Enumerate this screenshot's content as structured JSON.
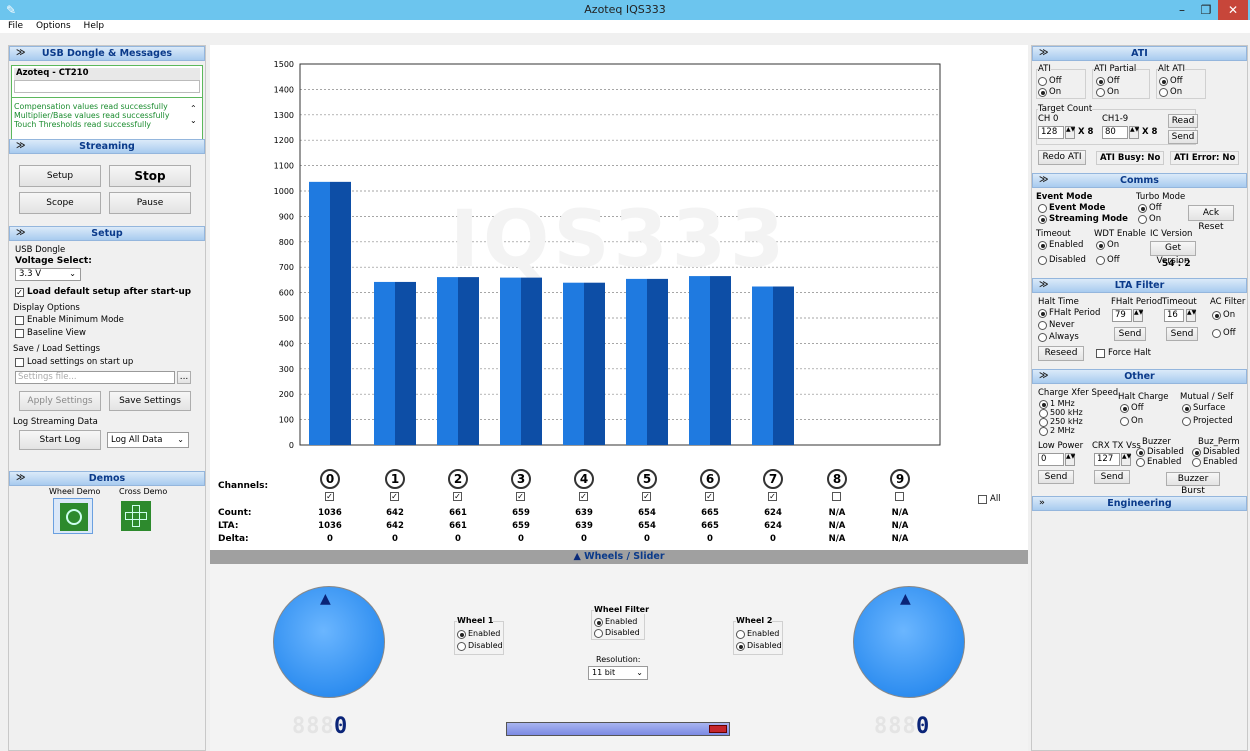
{
  "window": {
    "title": "Azoteq IQS333",
    "min": "–",
    "max": "❐",
    "close": "✕"
  },
  "menu": [
    "File",
    "Options",
    "Help"
  ],
  "left": {
    "usb_header": "USB Dongle & Messages",
    "device": "Azoteq - CT210",
    "messages": [
      "Compensation values read successfully",
      "Multiplier/Base values read successfully",
      "Touch Thresholds read successfully"
    ],
    "streaming_header": "Streaming",
    "setup_btn": "Setup",
    "stop_btn": "Stop",
    "scope_btn": "Scope",
    "pause_btn": "Pause",
    "setup_header": "Setup",
    "usb_dongle": "USB Dongle",
    "voltage_label": "Voltage Select:",
    "voltage_value": "3.3 V",
    "load_default": "Load default setup after start-up",
    "display_options": "Display Options",
    "enable_min": "Enable Minimum Mode",
    "baseline_view": "Baseline View",
    "save_load": "Save / Load Settings",
    "load_on_start": "Load settings on start up",
    "settings_placeholder": "Settings file...",
    "browse": "...",
    "apply_btn": "Apply Settings",
    "save_btn": "Save Settings",
    "log_label": "Log Streaming Data",
    "start_log": "Start Log",
    "log_option": "Log All Data",
    "demos_header": "Demos",
    "wheel_demo": "Wheel Demo",
    "cross_demo": "Cross Demo"
  },
  "chart_data": {
    "type": "bar",
    "categories": [
      "0",
      "1",
      "2",
      "3",
      "4",
      "5",
      "6",
      "7"
    ],
    "values": [
      1036,
      642,
      661,
      659,
      639,
      654,
      665,
      624
    ],
    "ylim": [
      0,
      1500
    ],
    "yticks": [
      0,
      100,
      200,
      300,
      400,
      500,
      600,
      700,
      800,
      900,
      1000,
      1100,
      1200,
      1300,
      1400,
      1500
    ],
    "grid": true,
    "watermark": "IQS333",
    "bar_color": "#1a6fd6"
  },
  "table": {
    "channels_label": "Channels:",
    "count_label": "Count:",
    "lta_label": "LTA:",
    "delta_label": "Delta:",
    "all_label": "All",
    "channels": [
      {
        "n": "0",
        "checked": true,
        "count": "1036",
        "lta": "1036",
        "delta": "0"
      },
      {
        "n": "1",
        "checked": true,
        "count": "642",
        "lta": "642",
        "delta": "0"
      },
      {
        "n": "2",
        "checked": true,
        "count": "661",
        "lta": "661",
        "delta": "0"
      },
      {
        "n": "3",
        "checked": true,
        "count": "659",
        "lta": "659",
        "delta": "0"
      },
      {
        "n": "4",
        "checked": true,
        "count": "639",
        "lta": "639",
        "delta": "0"
      },
      {
        "n": "5",
        "checked": true,
        "count": "654",
        "lta": "654",
        "delta": "0"
      },
      {
        "n": "6",
        "checked": true,
        "count": "665",
        "lta": "665",
        "delta": "0"
      },
      {
        "n": "7",
        "checked": true,
        "count": "624",
        "lta": "624",
        "delta": "0"
      },
      {
        "n": "8",
        "checked": false,
        "count": "N/A",
        "lta": "N/A",
        "delta": "N/A"
      },
      {
        "n": "9",
        "checked": false,
        "count": "N/A",
        "lta": "N/A",
        "delta": "N/A"
      }
    ]
  },
  "wheels": {
    "header": "Wheels / Slider",
    "wheel1": "Wheel 1",
    "wheel2": "Wheel 2",
    "enabled": "Enabled",
    "disabled": "Disabled",
    "filter": "Wheel Filter",
    "resolution": "Resolution:",
    "resolution_value": "11 bit",
    "wheel1_display": "0",
    "wheel2_display": "0"
  },
  "right": {
    "ati_header": "ATI",
    "ati": "ATI",
    "ati_partial": "ATI Partial",
    "alt_ati": "Alt ATI",
    "off": "Off",
    "on": "On",
    "target_count": "Target Count",
    "ch0": "CH 0",
    "ch19": "CH1-9",
    "ch0_val": "128",
    "ch19_val": "80",
    "x8": "X 8",
    "read_btn": "Read",
    "send_btn": "Send",
    "redo_ati": "Redo ATI",
    "ati_busy": "ATI Busy: No",
    "ati_error": "ATI Error: No",
    "comms_header": "Comms",
    "event_mode_title": "Event Mode",
    "event_mode": "Event Mode",
    "streaming_mode": "Streaming Mode",
    "turbo_mode": "Turbo Mode",
    "ack_reset": "Ack Reset",
    "timeout": "Timeout",
    "wdt_enable": "WDT Enable",
    "ic_version": "IC Version",
    "enabled": "Enabled",
    "disabled": "Disabled",
    "get_version": "Get Version",
    "version": "54 : 2",
    "lta_header": "LTA Filter",
    "halt_time": "Halt Time",
    "fhalt_period_opt": "FHalt Period",
    "never": "Never",
    "always": "Always",
    "fhalt_period": "FHalt Period",
    "fhalt_val": "79",
    "timeout_lbl": "Timeout",
    "timeout_val": "16",
    "ac_filter": "AC Filter",
    "reseed": "Reseed",
    "force_halt": "Force Halt",
    "other_header": "Other",
    "charge_xfer": "Charge Xfer Speed",
    "speeds": [
      "1 MHz",
      "500 kHz",
      "250 kHz",
      "2 MHz"
    ],
    "halt_charge": "Halt Charge",
    "mutual_self": "Mutual / Self",
    "surface": "Surface",
    "projected": "Projected",
    "low_power": "Low Power",
    "low_power_val": "0",
    "crx": "CRX TX Vss",
    "crx_val": "127",
    "buzzer": "Buzzer",
    "buz_perm": "Buz_Perm",
    "buzzer_burst": "Buzzer Burst",
    "engineering_header": "Engineering"
  }
}
